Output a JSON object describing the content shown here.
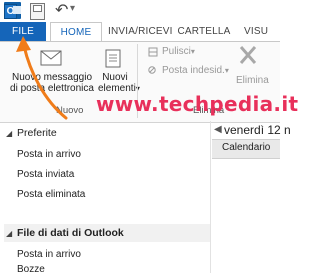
{
  "tabs": {
    "file": "FILE",
    "home": "HOME",
    "send_receive": "INVIA/RICEVI",
    "folder": "CARTELLA",
    "view": "VISU"
  },
  "ribbon": {
    "new_email_line1": "Nuovo messaggio",
    "new_email_line2": "di posta elettronica",
    "new_items_line1": "Nuovi",
    "new_items_line2": "elementi",
    "group_new": "Nuovo",
    "clean_up": "Pulisci",
    "junk": "Posta indesid.",
    "delete": "Elimina",
    "group_delete": "Elimina"
  },
  "watermark": "www.techpedia.it",
  "sidebar": {
    "favorites_header": "Preferite",
    "favorites": [
      "Posta in arrivo",
      "Posta inviata",
      "Posta eliminata"
    ],
    "data_file_header": "File di dati di Outlook",
    "data_file_items": [
      "Posta in arrivo",
      "Bozze"
    ]
  },
  "calendar": {
    "date": "venerdì 12 n",
    "label": "Calendario"
  },
  "colors": {
    "accent": "#1565b9",
    "watermark": "#e8305b",
    "arrow": "#f07c1a"
  }
}
